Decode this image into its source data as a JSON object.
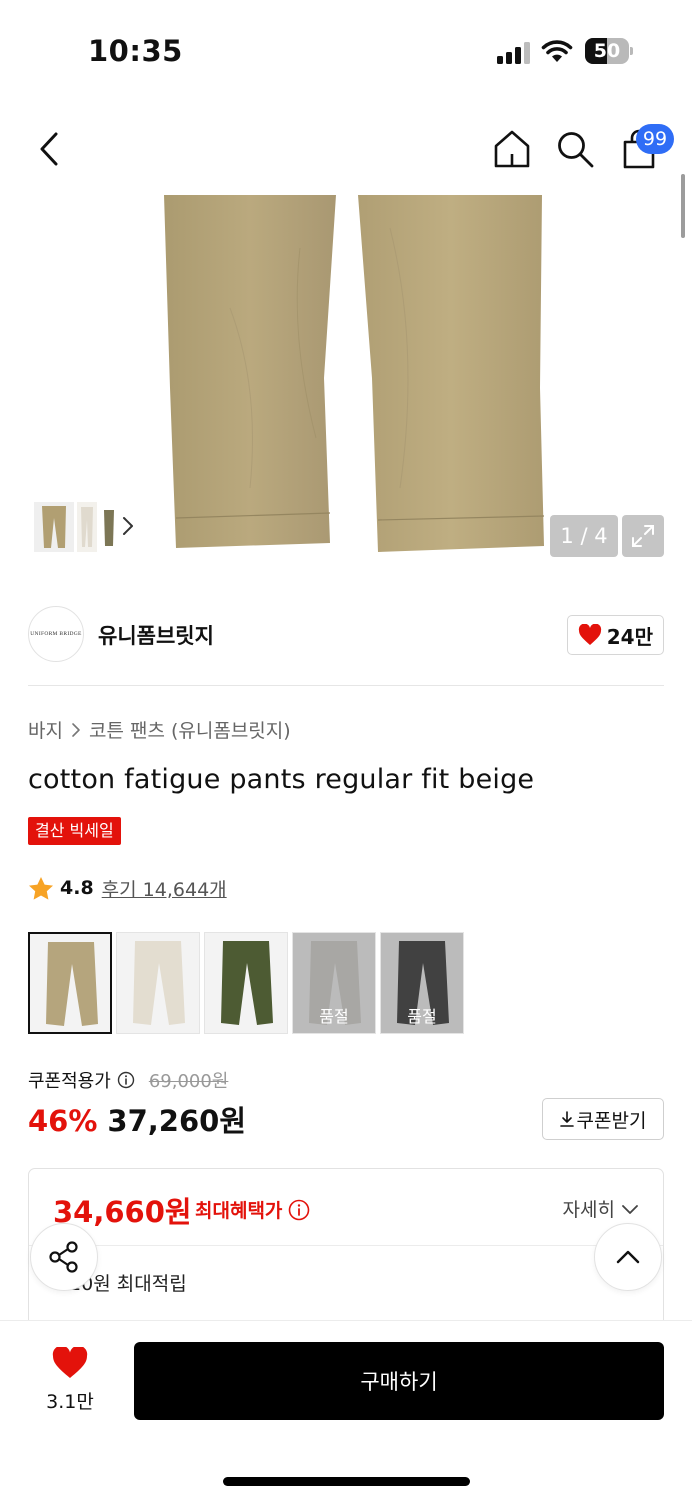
{
  "status_bar": {
    "time": "10:35",
    "battery": "50",
    "battery_level": 0.5
  },
  "header": {
    "cart_count": "99",
    "icons": [
      "back-icon",
      "home-icon",
      "search-icon",
      "shopping-bag-icon"
    ]
  },
  "gallery": {
    "counter": "1 / 4",
    "icons": [
      "chevron-right-icon",
      "expand-icon"
    ]
  },
  "brand": {
    "logo_text": "UNIFORM BRIDGE",
    "name": "유니폼브릿지",
    "likes": "24만"
  },
  "breadcrumb": {
    "category": "바지",
    "subcategory": "코튼 팬츠 (유니폼브릿지)"
  },
  "product": {
    "title": "cotton fatigue pants regular fit beige",
    "badge": "결산 빅세일",
    "rating": "4.8",
    "reviews": "후기 14,644개"
  },
  "color_options": [
    {
      "color": "#b5a57d",
      "selected": true,
      "soldout_label": ""
    },
    {
      "color": "#e3ddd0",
      "selected": false,
      "soldout_label": ""
    },
    {
      "color": "#4d5b33",
      "selected": false,
      "soldout_label": ""
    },
    {
      "color": "#d0cec8",
      "selected": false,
      "soldout_label": "품절"
    },
    {
      "color": "#141414",
      "selected": false,
      "soldout_label": "품절"
    }
  ],
  "price": {
    "coupon_label": "쿠폰적용가",
    "original": "69,000원",
    "discount": "46%",
    "sale": "37,260원",
    "coupon_button": "쿠폰받기"
  },
  "benefit": {
    "max_price": "34,660원",
    "max_label": "최대혜택가",
    "detail_link": "자세히",
    "points": "720원 최대적립"
  },
  "bottom_bar": {
    "wish_count": "3.1만",
    "buy_label": "구매하기"
  },
  "colors": {
    "accent_red": "#e3120b",
    "badge_blue": "#2f6df6",
    "primary_black": "#000000"
  }
}
